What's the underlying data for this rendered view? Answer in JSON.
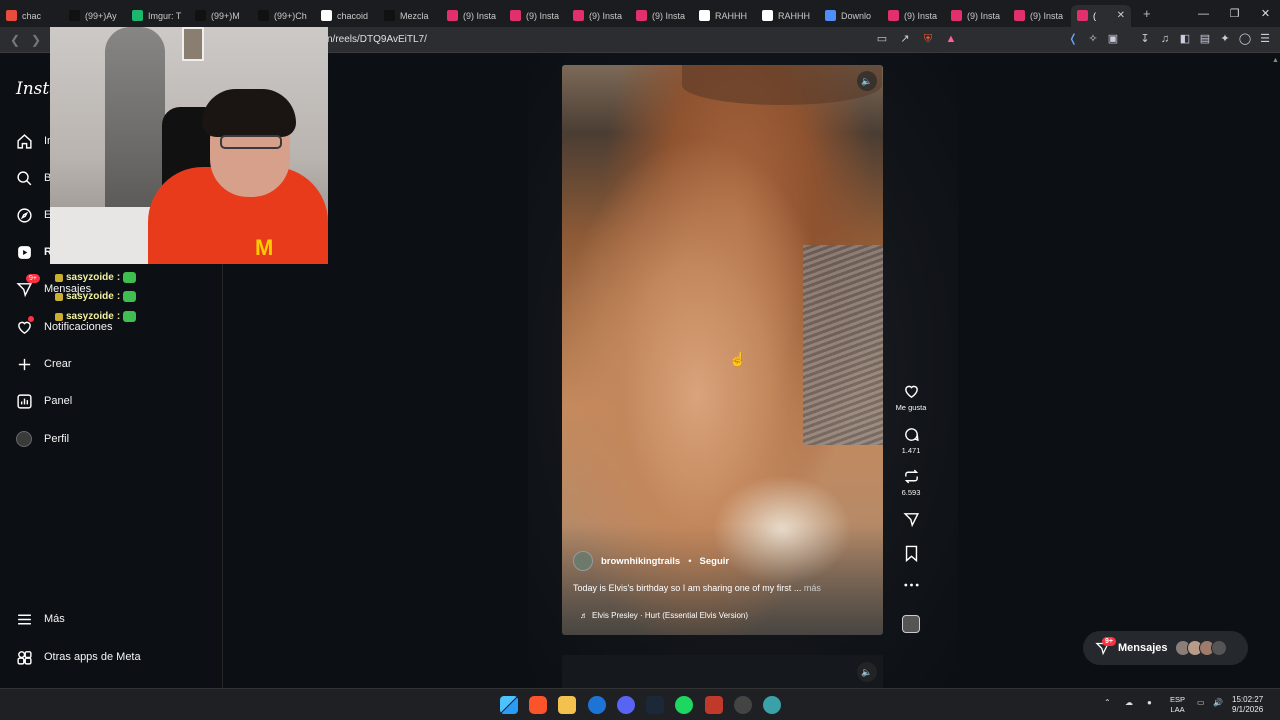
{
  "browser": {
    "tabs": [
      {
        "label": "chac",
        "color": "#e74c3c"
      },
      {
        "label": "(99+)Ay",
        "color": "#111111"
      },
      {
        "label": "Imgur: T",
        "color": "#1bb76e"
      },
      {
        "label": "(99+)M",
        "color": "#111111"
      },
      {
        "label": "(99+)Ch",
        "color": "#111111"
      },
      {
        "label": "chacoid",
        "color": "#ffffff"
      },
      {
        "label": "Mezcla",
        "color": "#111111"
      },
      {
        "label": "(9) Insta",
        "color": "#e1306c"
      },
      {
        "label": "(9) Insta",
        "color": "#e1306c"
      },
      {
        "label": "(9) Insta",
        "color": "#e1306c"
      },
      {
        "label": "(9) Insta",
        "color": "#e1306c"
      },
      {
        "label": "RAHHH",
        "color": "#ffffff"
      },
      {
        "label": "RAHHH",
        "color": "#ffffff"
      },
      {
        "label": "Downlo",
        "color": "#4e8ff7"
      },
      {
        "label": "(9) Insta",
        "color": "#e1306c"
      },
      {
        "label": "(9) Insta",
        "color": "#e1306c"
      },
      {
        "label": "(9) Insta",
        "color": "#e1306c"
      },
      {
        "label": "(",
        "color": "#e1306c"
      }
    ],
    "new_tab": "+",
    "url": "n/reels/DTQ9AvEiTL7/"
  },
  "sidebar": {
    "logo": "Insta",
    "items": [
      {
        "label": "In",
        "icon": "home-icon"
      },
      {
        "label": "B",
        "icon": "search-icon"
      },
      {
        "label": "E",
        "icon": "explore-icon"
      },
      {
        "label": "R",
        "icon": "reels-icon"
      },
      {
        "label": "Mensajes",
        "icon": "messenger-icon",
        "badge": "9+"
      },
      {
        "label": "Notificaciones",
        "icon": "heart-icon"
      },
      {
        "label": "Crear",
        "icon": "plus-icon"
      },
      {
        "label": "Panel",
        "icon": "dashboard-icon"
      },
      {
        "label": "Perfil",
        "icon": "avatar"
      }
    ],
    "more": "Más",
    "meta_apps": "Otras apps de Meta"
  },
  "chat": [
    {
      "user": "sasyzoide",
      "suffix": ":"
    },
    {
      "user": "sasyzoide",
      "suffix": ":"
    },
    {
      "user": "sasyzoide",
      "suffix": ":"
    }
  ],
  "reel": {
    "author": "brownhikingtrails",
    "separator": "•",
    "follow": "Seguir",
    "caption": "Today is Elvis's birthday so I am sharing one of my first",
    "caption_ellipsis": " ... ",
    "caption_more": "más",
    "audio_icon": "♬",
    "audio": "Elvis Presley · Hurt (Essential Elvis Version)"
  },
  "actions": {
    "like_label": "Me gusta",
    "comments": "1.471",
    "reposts": "6.593"
  },
  "messages_pill": {
    "label": "Mensajes",
    "badge": "9+"
  },
  "taskbar": {
    "lang_top": "ESP",
    "lang_bottom": "LAA",
    "time": "15:02:27",
    "date": "9/1/2026"
  }
}
